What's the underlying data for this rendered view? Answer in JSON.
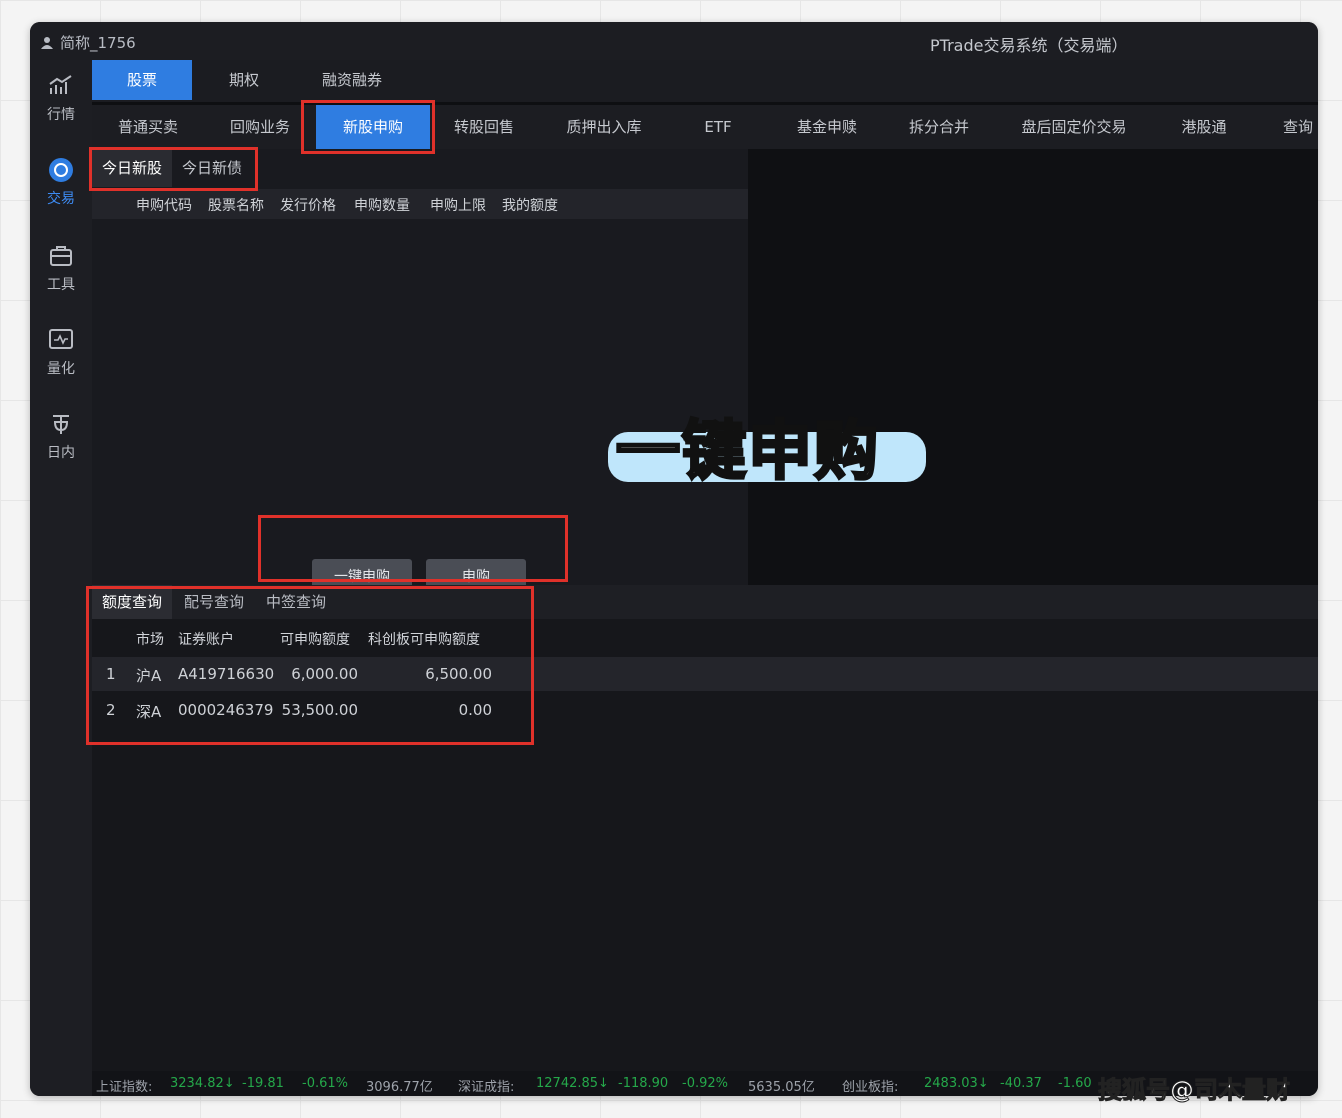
{
  "titlebar": {
    "user": "简称_1756",
    "title": "PTrade交易系统（交易端）"
  },
  "sidebar": [
    {
      "label": "行情",
      "icon": "chart-icon",
      "active": false
    },
    {
      "label": "交易",
      "icon": "trade-icon",
      "active": true
    },
    {
      "label": "工具",
      "icon": "toolbox-icon",
      "active": false
    },
    {
      "label": "量化",
      "icon": "quant-icon",
      "active": false
    },
    {
      "label": "日内",
      "icon": "intraday-icon",
      "active": false
    }
  ],
  "main_tabs": [
    "股票",
    "期权",
    "融资融券"
  ],
  "sub_tabs": [
    "普通买卖",
    "回购业务",
    "新股申购",
    "转股回售",
    "质押出入库",
    "ETF",
    "基金申赎",
    "拆分合并",
    "盘后固定价交易",
    "港股通",
    "查询"
  ],
  "today_tabs": [
    "今日新股",
    "今日新债"
  ],
  "columns": [
    "申购代码",
    "股票名称",
    "发行价格",
    "申购数量",
    "申购上限",
    "我的额度"
  ],
  "buttons": {
    "one_click": "一键申购",
    "subscribe": "申购"
  },
  "query_tabs": [
    "额度查询",
    "配号查询",
    "中签查询"
  ],
  "quota_table": {
    "headers": [
      "市场",
      "证券账户",
      "可申购额度",
      "科创板可申购额度"
    ],
    "rows": [
      {
        "idx": "1",
        "market": "沪A",
        "account": "A419716630",
        "quota": "6,000.00",
        "star_quota": "6,500.00"
      },
      {
        "idx": "2",
        "market": "深A",
        "account": "0000246379",
        "quota": "53,500.00",
        "star_quota": "0.00"
      }
    ]
  },
  "statusbar": {
    "sh_label": "上证指数:",
    "sh_value": "3234.82↓",
    "sh_change": "-19.81",
    "sh_pct": "-0.61%",
    "sh_amount": "3096.77亿",
    "sz_label": "深证成指:",
    "sz_value": "12742.85↓",
    "sz_change": "-118.90",
    "sz_pct": "-0.92%",
    "sz_amount": "5635.05亿",
    "cy_label": "创业板指:",
    "cy_value": "2483.03↓",
    "cy_change": "-40.37",
    "cy_pct": "-1.60"
  },
  "overlay_title": "一键申购",
  "watermark": "搜狐号@司木量财",
  "colors": {
    "accent": "#2f7de1",
    "highlight": "#e0312a",
    "down": "#25a84a"
  }
}
